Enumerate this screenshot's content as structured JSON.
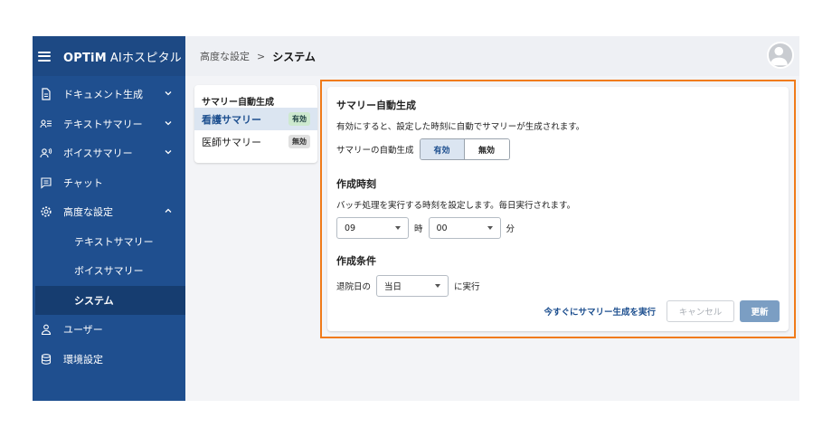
{
  "app": {
    "logo": "OPTiM",
    "logo_sub": "AIホスピタル"
  },
  "sidebar": {
    "items": [
      {
        "label": "ドキュメント生成",
        "icon": "document-icon"
      },
      {
        "label": "テキストサマリー",
        "icon": "text-summary-icon"
      },
      {
        "label": "ボイスサマリー",
        "icon": "voice-icon"
      },
      {
        "label": "チャット",
        "icon": "chat-icon"
      },
      {
        "label": "高度な設定",
        "icon": "gear-icon"
      },
      {
        "label": "テキストサマリー"
      },
      {
        "label": "ボイスサマリー"
      },
      {
        "label": "システム"
      },
      {
        "label": "ユーザー",
        "icon": "user-icon"
      },
      {
        "label": "環境設定",
        "icon": "database-icon"
      }
    ]
  },
  "breadcrumb": {
    "parent": "高度な設定",
    "separator": ">",
    "current": "システム"
  },
  "subpanel": {
    "title": "サマリー自動生成",
    "rows": [
      {
        "label": "看護サマリー",
        "badge": "有効"
      },
      {
        "label": "医師サマリー",
        "badge": "無効"
      }
    ]
  },
  "settings": {
    "auto": {
      "title": "サマリー自動生成",
      "desc": "有効にすると、設定した時刻に自動でサマリーが生成されます。",
      "field_label": "サマリーの自動生成",
      "on_label": "有効",
      "off_label": "無効"
    },
    "time": {
      "title": "作成時刻",
      "desc": "バッチ処理を実行する時刻を設定します。毎日実行されます。",
      "hour": "09",
      "hour_unit": "時",
      "minute": "00",
      "minute_unit": "分"
    },
    "condition": {
      "title": "作成条件",
      "prefix": "退院日の",
      "day": "当日",
      "suffix": "に実行"
    },
    "actions": {
      "run_now": "今すぐにサマリー生成を実行",
      "cancel": "キャンセル",
      "update": "更新"
    }
  },
  "colors": {
    "sidebar": "#1f4f8f",
    "highlight": "#f07b1a",
    "accent": "#1d4f8f"
  }
}
